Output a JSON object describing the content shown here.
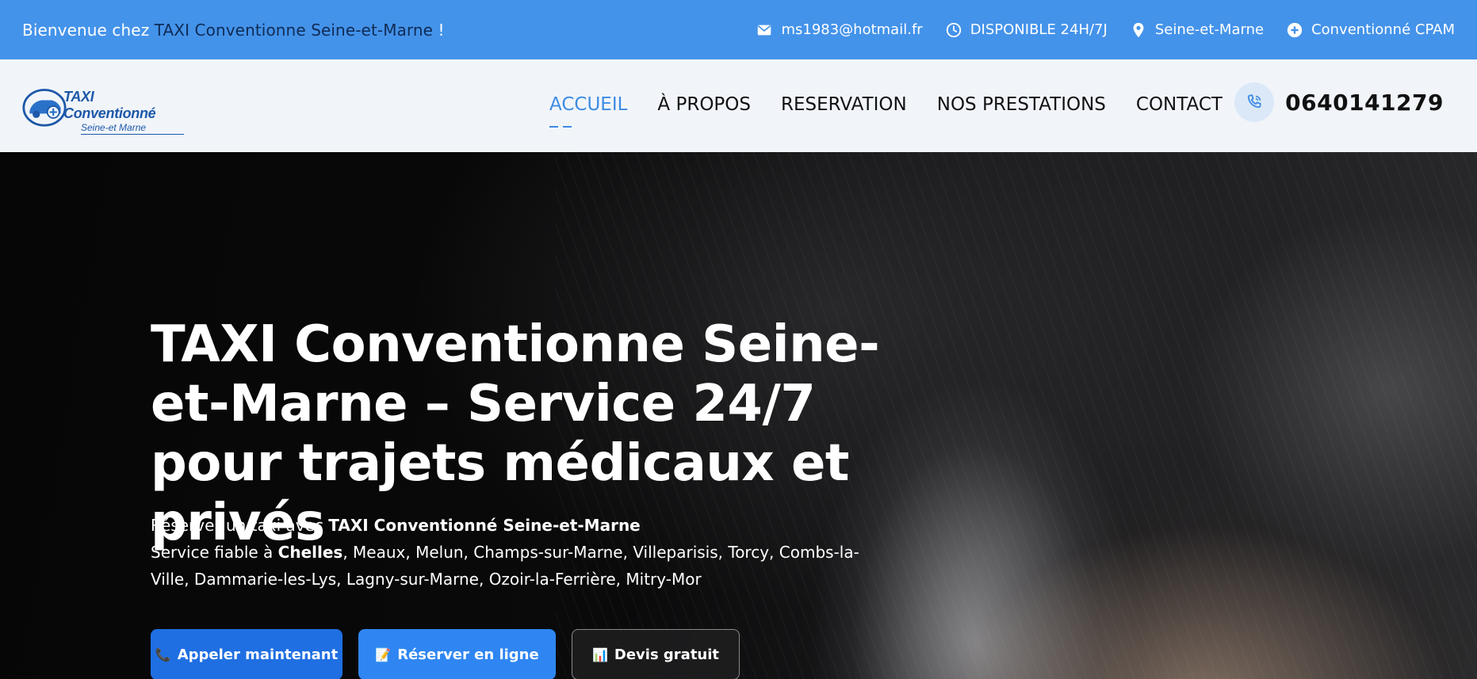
{
  "topbar": {
    "welcome_prefix": "Bienvenue chez ",
    "welcome_brand": "TAXI Conventionne Seine-et-Marne",
    "welcome_suffix": " !",
    "email": "ms1983@hotmail.fr",
    "availability": "DISPONIBLE 24H/7J",
    "location": "Seine-et-Marne",
    "cpam": "Conventionné CPAM"
  },
  "logo": {
    "title": "TAXI Conventionné",
    "subtitle": "Seine-et Marne"
  },
  "nav": {
    "items": [
      {
        "label": "ACCUEIL",
        "active": true
      },
      {
        "label": "À PROPOS"
      },
      {
        "label": "RESERVATION"
      },
      {
        "label": "NOS PRESTATIONS"
      },
      {
        "label": "CONTACT"
      }
    ]
  },
  "phone": {
    "number": "0640141279"
  },
  "hero": {
    "title": "TAXI Conventionne Seine-et-Marne – Service 24/7 pour trajets médicaux et privés",
    "line1_prefix": "Réserver un taxi avec ",
    "line1_bold": "TAXI Conventionné Seine-et-Marne",
    "line2_prefix": "Service fiable à ",
    "line2_bold": "Chelles",
    "line2_rest": ", Meaux, Melun, Champs-sur-Marne, Villeparisis, Torcy, Combs-la-Ville, Dammarie-les-Lys, Lagny-sur-Marne, Ozoir-la-Ferrière, Mitry-Mor",
    "buttons": {
      "call": "Appeler maintenant",
      "book": "Réserver en ligne",
      "quote": "Devis gratuit"
    }
  },
  "colors": {
    "topbar": "#4493ea",
    "header": "#f1f5fa",
    "accent": "#3d8be3",
    "btn_call": "#1f6fe2",
    "btn_book": "#2f86f2"
  }
}
